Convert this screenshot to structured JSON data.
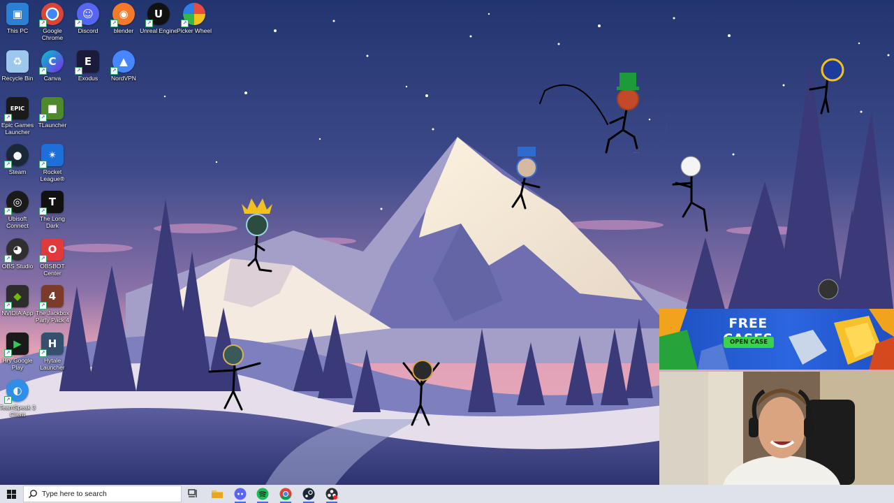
{
  "desktop": {
    "icons": [
      {
        "label": "This PC",
        "icon": "computer-icon"
      },
      {
        "label": "Google Chrome",
        "icon": "chrome-icon"
      },
      {
        "label": "Discord",
        "icon": "discord-icon"
      },
      {
        "label": "blender",
        "icon": "blender-icon"
      },
      {
        "label": "Unreal Engine",
        "icon": "unreal-engine-icon"
      },
      {
        "label": "Picker Wheel",
        "icon": "picker-wheel-icon"
      },
      {
        "label": "Recycle Bin",
        "icon": "recycle-bin-icon"
      },
      {
        "label": "Canva",
        "icon": "canva-icon"
      },
      {
        "label": "Exodus",
        "icon": "exodus-icon"
      },
      {
        "label": "NordVPN",
        "icon": "nordvpn-icon"
      },
      {
        "label": "Epic Games Launcher",
        "icon": "epic-games-icon"
      },
      {
        "label": "TLauncher",
        "icon": "tlauncher-icon"
      },
      {
        "label": "Steam",
        "icon": "steam-icon"
      },
      {
        "label": "Rocket League®",
        "icon": "rocket-league-icon"
      },
      {
        "label": "Ubisoft Connect",
        "icon": "ubisoft-icon"
      },
      {
        "label": "The Long Dark",
        "icon": "the-long-dark-icon"
      },
      {
        "label": "OBS Studio",
        "icon": "obs-icon"
      },
      {
        "label": "OBSBOT Center",
        "icon": "obsbot-icon"
      },
      {
        "label": "NVIDIA App",
        "icon": "nvidia-icon"
      },
      {
        "label": "The Jackbox Party Pack 4",
        "icon": "jackbox-icon"
      },
      {
        "label": "Hry Google Play",
        "icon": "google-play-games-icon"
      },
      {
        "label": "Hytale Launcher",
        "icon": "hytale-icon"
      },
      {
        "label": "TeamSpeak 3 Client",
        "icon": "teamspeak-icon"
      }
    ]
  },
  "promo": {
    "title": "FREE CASES",
    "button": "OPEN CASE"
  },
  "taskbar": {
    "search_placeholder": "Type here to search",
    "apps": [
      {
        "name": "Task View",
        "icon": "task-view-icon"
      },
      {
        "name": "File Explorer",
        "icon": "file-explorer-icon"
      },
      {
        "name": "Discord",
        "icon": "discord-icon"
      },
      {
        "name": "Spotify",
        "icon": "spotify-icon"
      },
      {
        "name": "Google Chrome",
        "icon": "chrome-icon"
      },
      {
        "name": "Steam",
        "icon": "steam-icon"
      },
      {
        "name": "OBS Studio",
        "icon": "obs-icon"
      }
    ]
  },
  "colors": {
    "sky_top": "#263a7a",
    "sky_mid": "#7a6aa8",
    "sky_horizon": "#e6a3b9",
    "snow": "#f5ecd9",
    "taskbar": "#dfe2ea",
    "promo_blue": "#2b66e0",
    "promo_green": "#3ad24a"
  }
}
